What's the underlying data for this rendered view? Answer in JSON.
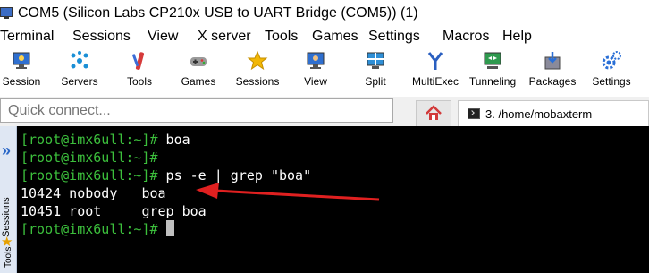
{
  "window": {
    "title": "COM5  (Silicon Labs CP210x USB to UART Bridge (COM5)) (1)"
  },
  "menu": {
    "items": [
      "Terminal",
      "Sessions",
      "View",
      "X server",
      "Tools",
      "Games",
      "Settings",
      "Macros",
      "Help"
    ]
  },
  "toolbar": {
    "buttons": [
      {
        "label": "Session",
        "icon": "session-icon"
      },
      {
        "label": "Servers",
        "icon": "servers-icon"
      },
      {
        "label": "Tools",
        "icon": "tools-icon"
      },
      {
        "label": "Games",
        "icon": "games-icon"
      },
      {
        "label": "Sessions",
        "icon": "star-icon"
      },
      {
        "label": "View",
        "icon": "view-icon"
      },
      {
        "label": "Split",
        "icon": "split-icon"
      },
      {
        "label": "MultiExec",
        "icon": "multiexec-icon"
      },
      {
        "label": "Tunneling",
        "icon": "tunneling-icon"
      },
      {
        "label": "Packages",
        "icon": "packages-icon"
      },
      {
        "label": "Settings",
        "icon": "settings-icon"
      }
    ]
  },
  "quick_connect": {
    "placeholder": "Quick connect..."
  },
  "tabs": {
    "home_icon": "home-icon",
    "terminal_tab_label": "3. /home/mobaxterm"
  },
  "sidebar": {
    "sessions_label": "Sessions",
    "tools_label": "Tools"
  },
  "terminal": {
    "lines": [
      {
        "prompt": "[root@imx6ull:~]#",
        "text": " boa"
      },
      {
        "prompt": "[root@imx6ull:~]#",
        "text": ""
      },
      {
        "prompt": "[root@imx6ull:~]#",
        "text": " ps -e | grep \"boa\""
      },
      {
        "prompt": "",
        "text": "10424 nobody   boa"
      },
      {
        "prompt": "",
        "text": "10451 root     grep boa"
      },
      {
        "prompt": "[root@imx6ull:~]#",
        "text": " "
      }
    ]
  },
  "colors": {
    "prompt": "#3cbf3c",
    "terminal_bg": "#000000",
    "annotation_arrow": "#e02020"
  }
}
